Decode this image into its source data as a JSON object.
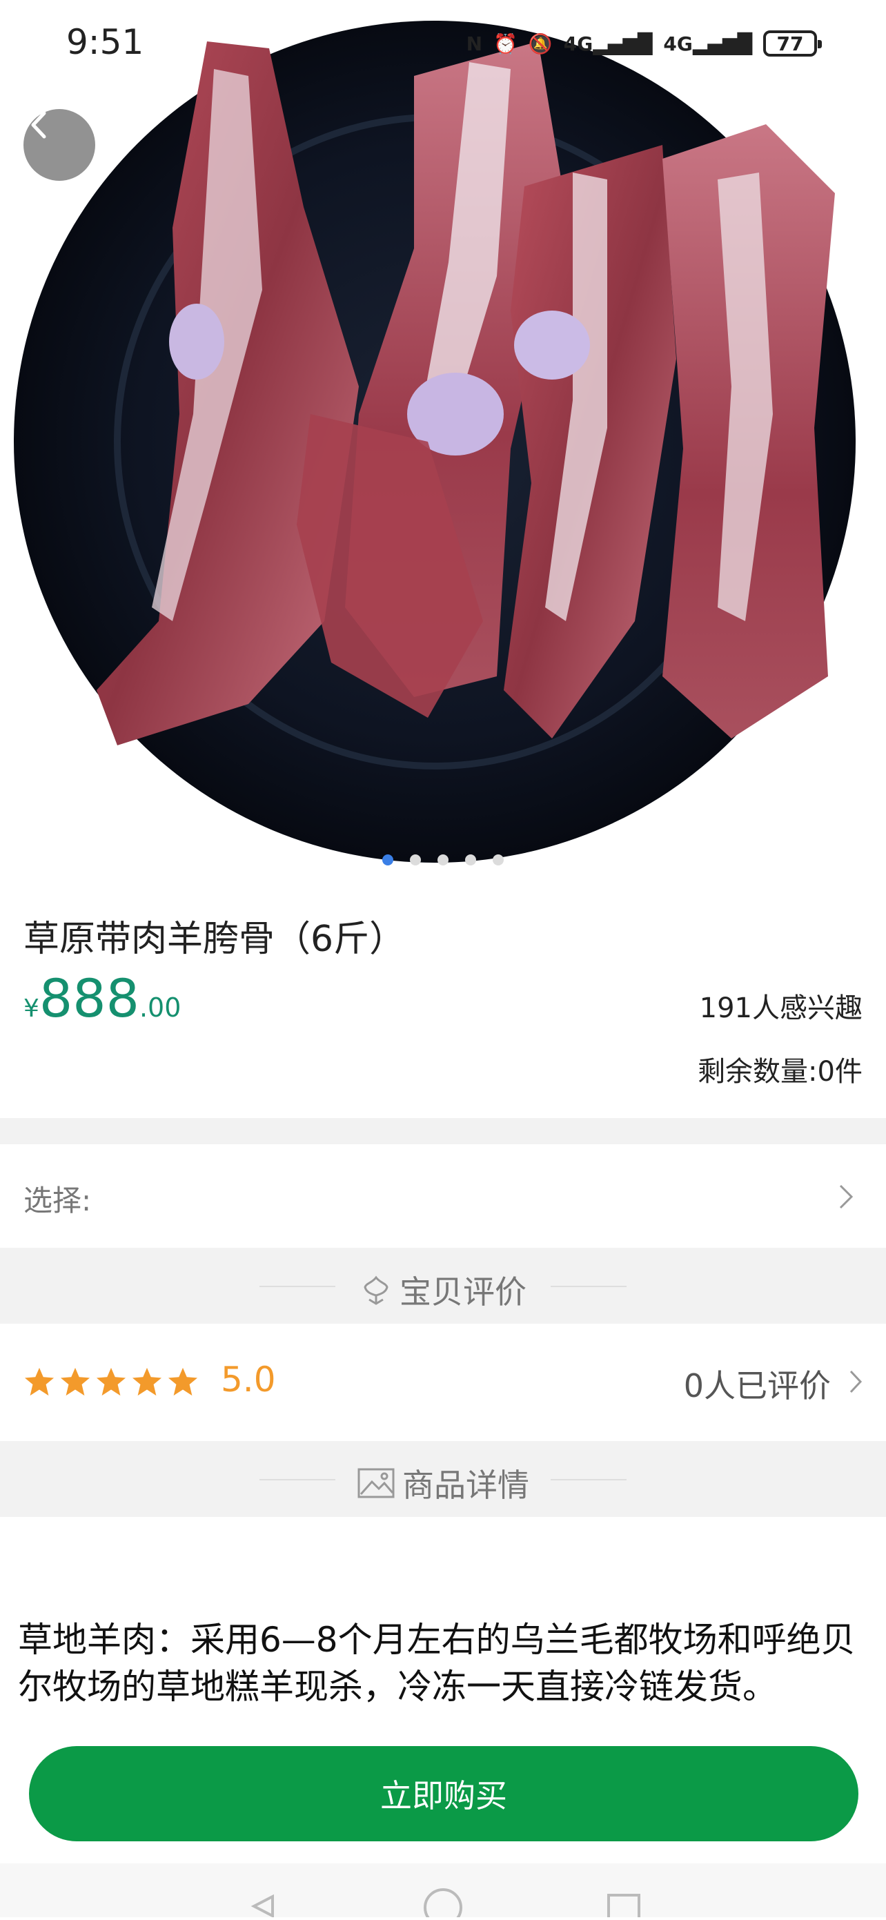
{
  "status_bar": {
    "time": "9:51",
    "nfc": "N",
    "signal_1": "4G",
    "signal_2": "4G",
    "battery": "77"
  },
  "carousel": {
    "image_count": 5,
    "active_index": 0
  },
  "product": {
    "title": "草原带肉羊胯骨（6斤）",
    "price_currency": "¥",
    "price_integer": "888",
    "price_decimal": ".00",
    "interest": "191人感兴趣",
    "stock": "剩余数量:0件"
  },
  "options": {
    "select_label": "选择:"
  },
  "reviews_section": {
    "title": "宝贝评价",
    "rating": 5,
    "score_text": "5.0",
    "review_count": "0人已评价"
  },
  "details_section": {
    "title": "商品详情",
    "description": "草地羊肉：采用6—8个月左右的乌兰毛都牧场和呼绝贝尔牧场的草地糕羊现杀，冷冻一天直接冷链发货。"
  },
  "actions": {
    "buy_now": "立即购买"
  },
  "colors": {
    "price": "#15906f",
    "rating": "#f39a2b",
    "buy_button": "#0b9a47",
    "carousel_active_dot": "#3a7fe6"
  },
  "icons": [
    "back-arrow-icon",
    "flower-icon",
    "image-icon",
    "chevron-right-icon",
    "star-icon"
  ]
}
